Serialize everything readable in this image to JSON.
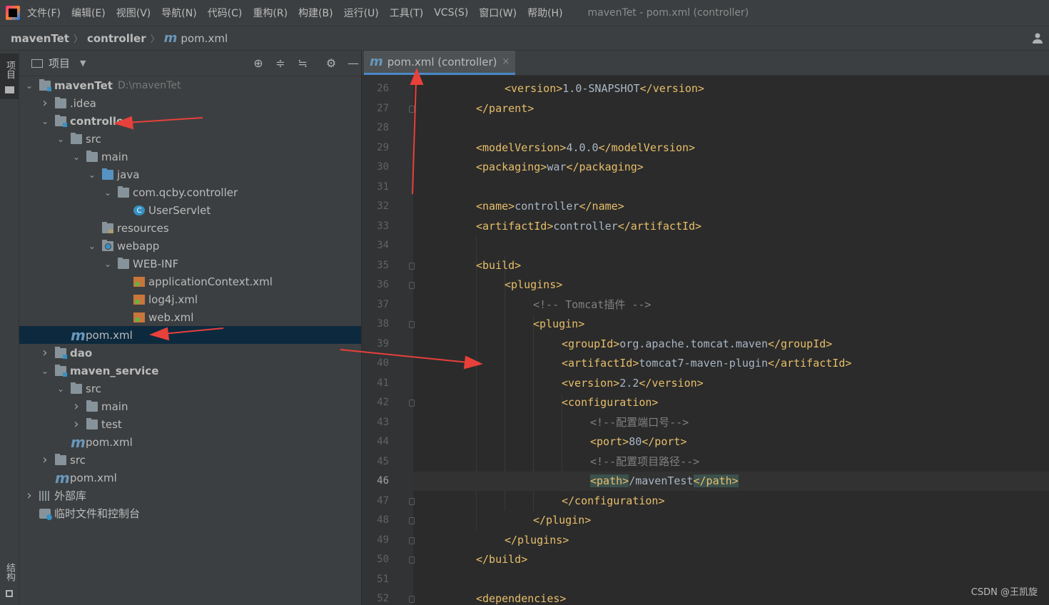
{
  "menubar": {
    "items": [
      "文件(F)",
      "编辑(E)",
      "视图(V)",
      "导航(N)",
      "代码(C)",
      "重构(R)",
      "构建(B)",
      "运行(U)",
      "工具(T)",
      "VCS(S)",
      "窗口(W)",
      "帮助(H)"
    ],
    "window_title": "mavenTet - pom.xml (controller)"
  },
  "breadcrumb": {
    "project": "mavenTet",
    "module": "controller",
    "file": "pom.xml",
    "maven_glyph": "m"
  },
  "side_strip": {
    "project_tab": "项目",
    "structure_tab": "结构"
  },
  "project_panel": {
    "title": "项目",
    "tools": [
      "locate-icon",
      "expand-all-icon",
      "collapse-all-icon",
      "gear-icon",
      "minimize-icon"
    ],
    "tree": [
      {
        "label": "mavenTet",
        "path": "D:\\mavenTet",
        "depth": 0,
        "arrow": "down",
        "icon": "module-folder",
        "bold": true
      },
      {
        "label": ".idea",
        "depth": 1,
        "arrow": "right",
        "icon": "folder"
      },
      {
        "label": "controller",
        "depth": 1,
        "arrow": "down",
        "icon": "module-folder",
        "bold": true
      },
      {
        "label": "src",
        "depth": 2,
        "arrow": "down",
        "icon": "folder"
      },
      {
        "label": "main",
        "depth": 3,
        "arrow": "down",
        "icon": "folder"
      },
      {
        "label": "java",
        "depth": 4,
        "arrow": "down",
        "icon": "source-folder"
      },
      {
        "label": "com.qcby.controller",
        "depth": 5,
        "arrow": "down",
        "icon": "package"
      },
      {
        "label": "UserServlet",
        "depth": 6,
        "arrow": "",
        "icon": "class"
      },
      {
        "label": "resources",
        "depth": 4,
        "arrow": "",
        "icon": "resources-folder"
      },
      {
        "label": "webapp",
        "depth": 4,
        "arrow": "down",
        "icon": "web-folder"
      },
      {
        "label": "WEB-INF",
        "depth": 5,
        "arrow": "down",
        "icon": "folder"
      },
      {
        "label": "applicationContext.xml",
        "depth": 6,
        "arrow": "",
        "icon": "xml"
      },
      {
        "label": "log4j.xml",
        "depth": 6,
        "arrow": "",
        "icon": "xml"
      },
      {
        "label": "web.xml",
        "depth": 6,
        "arrow": "",
        "icon": "xml"
      },
      {
        "label": "pom.xml",
        "depth": 2,
        "arrow": "",
        "icon": "maven",
        "selected": true
      },
      {
        "label": "dao",
        "depth": 1,
        "arrow": "right",
        "icon": "module-folder",
        "bold": true
      },
      {
        "label": "maven_service",
        "depth": 1,
        "arrow": "down",
        "icon": "module-folder",
        "bold": true
      },
      {
        "label": "src",
        "depth": 2,
        "arrow": "down",
        "icon": "folder"
      },
      {
        "label": "main",
        "depth": 3,
        "arrow": "right",
        "icon": "folder"
      },
      {
        "label": "test",
        "depth": 3,
        "arrow": "right",
        "icon": "folder"
      },
      {
        "label": "pom.xml",
        "depth": 2,
        "arrow": "",
        "icon": "maven"
      },
      {
        "label": "src",
        "depth": 1,
        "arrow": "right",
        "icon": "folder"
      },
      {
        "label": "pom.xml",
        "depth": 1,
        "arrow": "",
        "icon": "maven"
      },
      {
        "label": "外部库",
        "depth": 0,
        "arrow": "right",
        "icon": "library"
      },
      {
        "label": "临时文件和控制台",
        "depth": 0,
        "arrow": "",
        "icon": "scratches"
      }
    ]
  },
  "editor": {
    "tab_label": "pom.xml (controller)",
    "tab_glyph": "m",
    "close_glyph": "×",
    "current_line": 46,
    "lines": [
      {
        "n": 26,
        "indent": 2,
        "parts": [
          [
            "t",
            "<version>"
          ],
          [
            "v",
            "1.0-SNAPSHOT"
          ],
          [
            "t",
            "</version>"
          ]
        ]
      },
      {
        "n": 27,
        "indent": 1,
        "parts": [
          [
            "t",
            "</parent>"
          ]
        ]
      },
      {
        "n": 28,
        "indent": 0,
        "parts": []
      },
      {
        "n": 29,
        "indent": 1,
        "parts": [
          [
            "t",
            "<modelVersion>"
          ],
          [
            "v",
            "4.0.0"
          ],
          [
            "t",
            "</modelVersion>"
          ]
        ]
      },
      {
        "n": 30,
        "indent": 1,
        "parts": [
          [
            "t",
            "<packaging>"
          ],
          [
            "v",
            "war"
          ],
          [
            "t",
            "</packaging>"
          ]
        ]
      },
      {
        "n": 31,
        "indent": 0,
        "parts": []
      },
      {
        "n": 32,
        "indent": 1,
        "parts": [
          [
            "t",
            "<name>"
          ],
          [
            "v",
            "controller"
          ],
          [
            "t",
            "</name>"
          ]
        ]
      },
      {
        "n": 33,
        "indent": 1,
        "parts": [
          [
            "t",
            "<artifactId>"
          ],
          [
            "v",
            "controller"
          ],
          [
            "t",
            "</artifactId>"
          ]
        ]
      },
      {
        "n": 34,
        "indent": 0,
        "parts": []
      },
      {
        "n": 35,
        "indent": 1,
        "parts": [
          [
            "t",
            "<build>"
          ]
        ]
      },
      {
        "n": 36,
        "indent": 2,
        "parts": [
          [
            "t",
            "<plugins>"
          ]
        ]
      },
      {
        "n": 37,
        "indent": 3,
        "parts": [
          [
            "c",
            "<!-- Tomcat插件 -->"
          ]
        ]
      },
      {
        "n": 38,
        "indent": 3,
        "parts": [
          [
            "t",
            "<plugin>"
          ]
        ]
      },
      {
        "n": 39,
        "indent": 4,
        "parts": [
          [
            "t",
            "<groupId>"
          ],
          [
            "v",
            "org.apache.tomcat.maven"
          ],
          [
            "t",
            "</groupId>"
          ]
        ]
      },
      {
        "n": 40,
        "indent": 4,
        "parts": [
          [
            "t",
            "<artifactId>"
          ],
          [
            "v",
            "tomcat7-maven-plugin"
          ],
          [
            "t",
            "</artifactId>"
          ]
        ]
      },
      {
        "n": 41,
        "indent": 4,
        "parts": [
          [
            "t",
            "<version>"
          ],
          [
            "v",
            "2.2"
          ],
          [
            "t",
            "</version>"
          ]
        ]
      },
      {
        "n": 42,
        "indent": 4,
        "parts": [
          [
            "t",
            "<configuration>"
          ]
        ]
      },
      {
        "n": 43,
        "indent": 5,
        "parts": [
          [
            "c",
            "<!--配置端口号-->"
          ]
        ]
      },
      {
        "n": 44,
        "indent": 5,
        "parts": [
          [
            "t",
            "<port>"
          ],
          [
            "v",
            "80"
          ],
          [
            "t",
            "</port>"
          ]
        ]
      },
      {
        "n": 45,
        "indent": 5,
        "parts": [
          [
            "c",
            "<!--配置项目路径-->"
          ]
        ]
      },
      {
        "n": 46,
        "indent": 5,
        "parts": [
          [
            "h",
            "<path>"
          ],
          [
            "v",
            "/mavenTest"
          ],
          [
            "h",
            "</path>"
          ]
        ]
      },
      {
        "n": 47,
        "indent": 4,
        "parts": [
          [
            "t",
            "</configuration>"
          ]
        ]
      },
      {
        "n": 48,
        "indent": 3,
        "parts": [
          [
            "t",
            "</plugin>"
          ]
        ]
      },
      {
        "n": 49,
        "indent": 2,
        "parts": [
          [
            "t",
            "</plugins>"
          ]
        ]
      },
      {
        "n": 50,
        "indent": 1,
        "parts": [
          [
            "t",
            "</build>"
          ]
        ]
      },
      {
        "n": 51,
        "indent": 0,
        "parts": []
      },
      {
        "n": 52,
        "indent": 1,
        "parts": [
          [
            "t",
            "<dependencies>"
          ]
        ]
      }
    ],
    "fold_lines": [
      27,
      35,
      36,
      38,
      42,
      47,
      48,
      49,
      50,
      52
    ]
  },
  "watermark": "CSDN @王凯旋",
  "colors": {
    "accent": "#4a88c7",
    "xml_tag": "#e8bf6a",
    "annotation_arrow": "#e8403a",
    "selection": "#0d293e"
  }
}
